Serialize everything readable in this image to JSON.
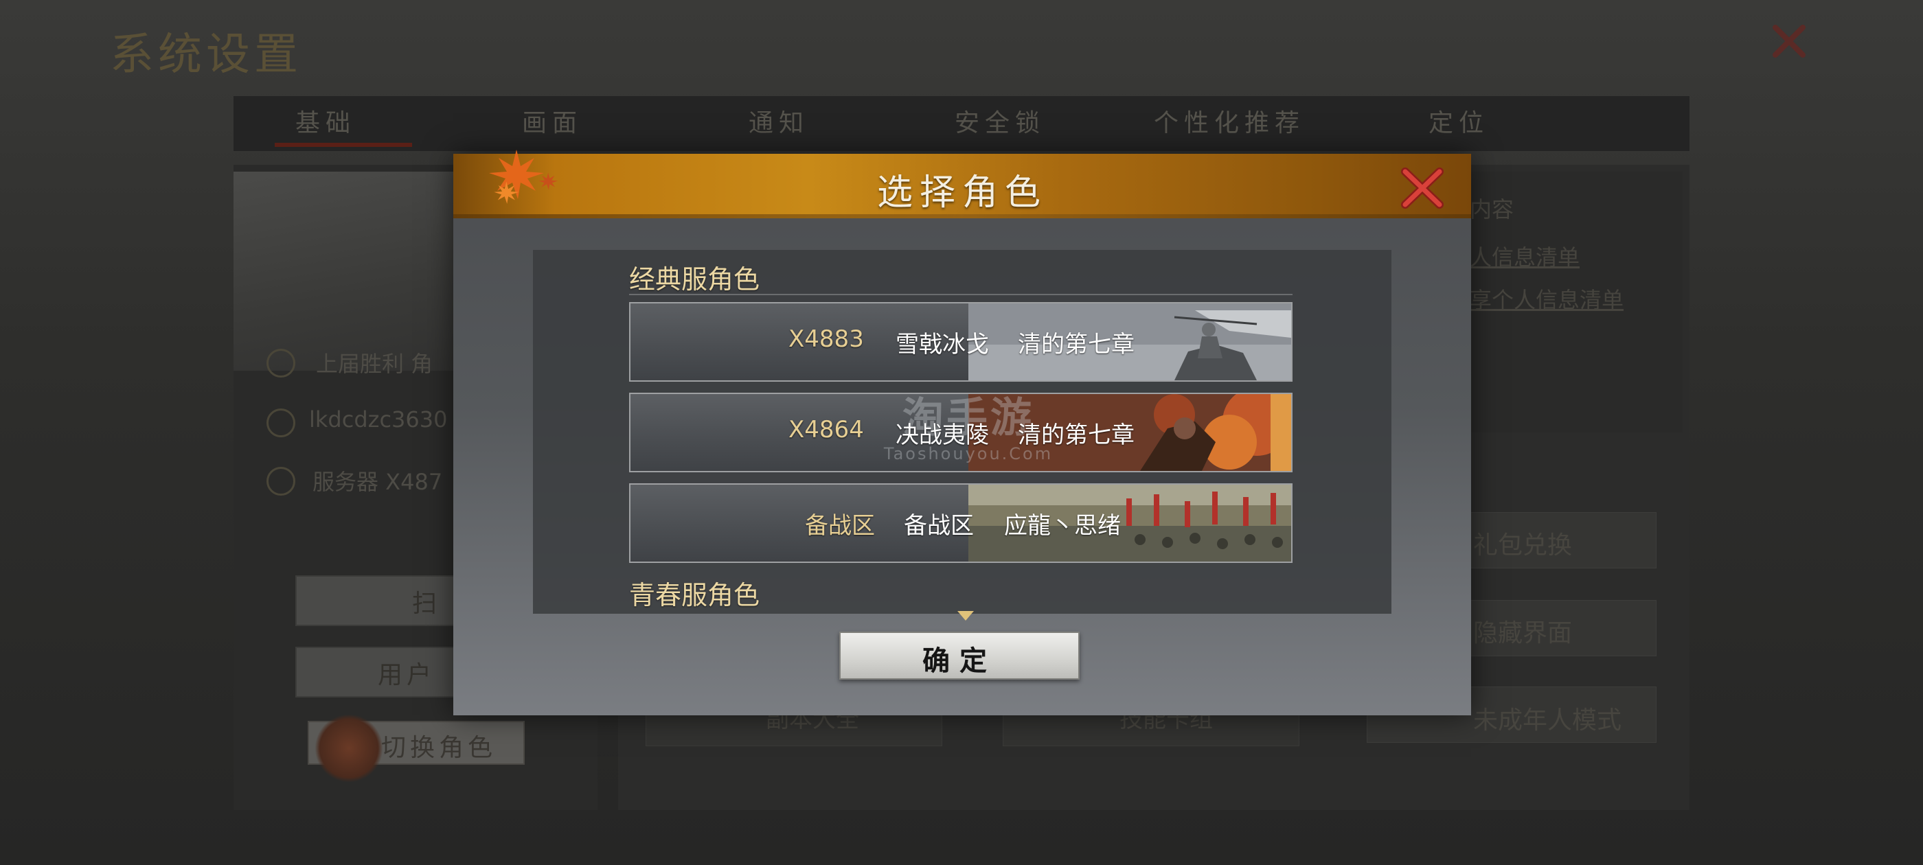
{
  "background": {
    "title": "系统设置",
    "tabs": [
      "基础",
      "画面",
      "通知",
      "安全锁",
      "个性化推荐",
      "定位"
    ],
    "info_rows": [
      "上届胜利  角",
      "lkdcdzc3630",
      "服务器 X487"
    ],
    "left_buttons": [
      "扫",
      "用户",
      "切换角色"
    ],
    "right_links": [
      "内容",
      "人信息清单",
      "享个人信息清单"
    ],
    "right_cards": [
      "礼包兑换",
      "隐藏界面",
      "未成年人模式"
    ],
    "bottom_cards": [
      "副本大全",
      "技能卡组"
    ]
  },
  "modal": {
    "title": "选择角色",
    "sections": [
      {
        "title": "经典服角色",
        "roles": [
          {
            "server": "X4883",
            "zone": "雪戟冰戈",
            "name": "清的第七章",
            "art": "general-on-horse"
          },
          {
            "server": "X4864",
            "zone": "决战夷陵",
            "name": "清的第七章",
            "art": "burning-battle"
          },
          {
            "server": "备战区",
            "zone": "备战区",
            "name": "应龍丶思绪",
            "art": "army-with-red-banners"
          }
        ]
      },
      {
        "title": "青春服角色",
        "roles": []
      }
    ],
    "confirm_label": "确定"
  },
  "watermark": {
    "cn": "淘手游",
    "en": "Taoshouyou.Com"
  },
  "colors": {
    "header_orange": "#c88a18",
    "server_gold": "#e7cf94",
    "section_gold": "#ecd8a4",
    "close_red": "#d9413a"
  }
}
